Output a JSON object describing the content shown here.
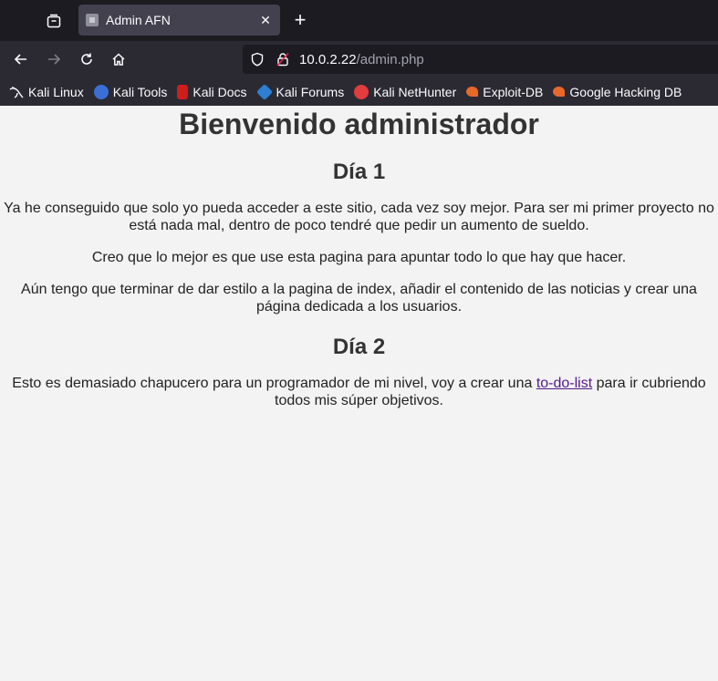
{
  "browser": {
    "tab_title": "Admin AFN",
    "close_glyph": "✕",
    "new_tab_glyph": "+",
    "url_host": "10.0.2.22",
    "url_path": "/admin.php"
  },
  "bookmarks": [
    {
      "label": "Kali Linux",
      "icon": "kali-dragon-icon",
      "color": "#1c1b22"
    },
    {
      "label": "Kali Tools",
      "icon": "kali-tools-icon",
      "color": "#3b6fd6"
    },
    {
      "label": "Kali Docs",
      "icon": "kali-docs-icon",
      "color": "#d11c1c"
    },
    {
      "label": "Kali Forums",
      "icon": "kali-forums-icon",
      "color": "#2d7fd3"
    },
    {
      "label": "Kali NetHunter",
      "icon": "kali-nethunter-icon",
      "color": "#e23c3c"
    },
    {
      "label": "Exploit-DB",
      "icon": "exploit-db-icon",
      "color": "#e8682a"
    },
    {
      "label": "Google Hacking DB",
      "icon": "ghdb-icon",
      "color": "#e8682a"
    }
  ],
  "page": {
    "heading": "Bienvenido administrador",
    "day1_title": "Día 1",
    "day1_p1": "Ya he conseguido que solo yo pueda acceder a este sitio, cada vez soy mejor. Para ser mi primer proyecto no está nada mal, dentro de poco tendré que pedir un aumento de sueldo.",
    "day1_p2": "Creo que lo mejor es que use esta pagina para apuntar todo lo que hay que hacer.",
    "day1_p3": "Aún tengo que terminar de dar estilo a la pagina de index, añadir el contenido de las noticias y crear una página dedicada a los usuarios.",
    "day2_title": "Día 2",
    "day2_p1_before": "Esto es demasiado chapucero para un programador de mi nivel, voy a crear una ",
    "day2_link": "to-do-list",
    "day2_p1_after": " para ir cubriendo todos mis súper objetivos."
  }
}
